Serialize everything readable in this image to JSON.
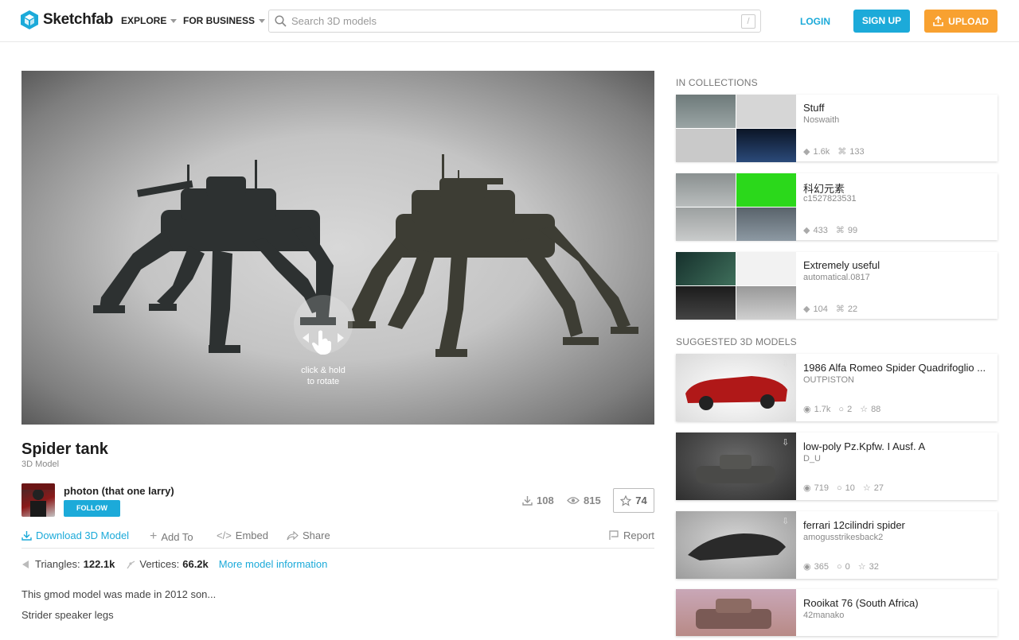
{
  "header": {
    "logo_text": "Sketchfab",
    "nav": [
      {
        "label": "EXPLORE"
      },
      {
        "label": "FOR BUSINESS"
      }
    ],
    "search_placeholder": "Search 3D models",
    "search_shortcut": "/",
    "login": "LOGIN",
    "signup": "SIGN UP",
    "upload": "UPLOAD"
  },
  "viewer": {
    "hint_line1": "click & hold",
    "hint_line2": "to rotate"
  },
  "model": {
    "title": "Spider tank",
    "subtitle": "3D Model",
    "author": "photon (that one larry)",
    "follow": "FOLLOW",
    "downloads": "108",
    "views": "815",
    "likes": "74",
    "actions": {
      "download": "Download 3D Model",
      "add_to": "Add To",
      "embed": "Embed",
      "share": "Share",
      "report": "Report"
    },
    "specs": {
      "triangles_label": "Triangles:",
      "triangles": "122.1k",
      "vertices_label": "Vertices:",
      "vertices": "66.2k",
      "more": "More model information"
    },
    "description": [
      "This gmod model was made in 2012 son...",
      "Strider speaker legs"
    ]
  },
  "sidebar": {
    "collections_title": "IN COLLECTIONS",
    "collections": [
      {
        "name": "Stuff",
        "owner": "Noswaith",
        "models": "1.6k",
        "subs": "133"
      },
      {
        "name": "科幻元素",
        "owner": "c1527823531",
        "models": "433",
        "subs": "99"
      },
      {
        "name": "Extremely useful",
        "owner": "automatical.0817",
        "models": "104",
        "subs": "22"
      }
    ],
    "suggested_title": "SUGGESTED 3D MODELS",
    "suggested": [
      {
        "name": "1986 Alfa Romeo Spider Quadrifoglio ...",
        "owner": "OUTPISTON",
        "views": "1.7k",
        "comments": "2",
        "likes": "88"
      },
      {
        "name": "low-poly Pz.Kpfw. I Ausf. A",
        "owner": "D_U",
        "views": "719",
        "comments": "10",
        "likes": "27"
      },
      {
        "name": "ferrari 12cilindri spider",
        "owner": "amogusstrikesback2",
        "views": "365",
        "comments": "0",
        "likes": "32"
      },
      {
        "name": "Rooikat 76 (South Africa)",
        "owner": "42manako",
        "views": "",
        "comments": "",
        "likes": ""
      }
    ]
  },
  "colors": {
    "accent": "#1caad9",
    "upload": "#f8a130"
  }
}
